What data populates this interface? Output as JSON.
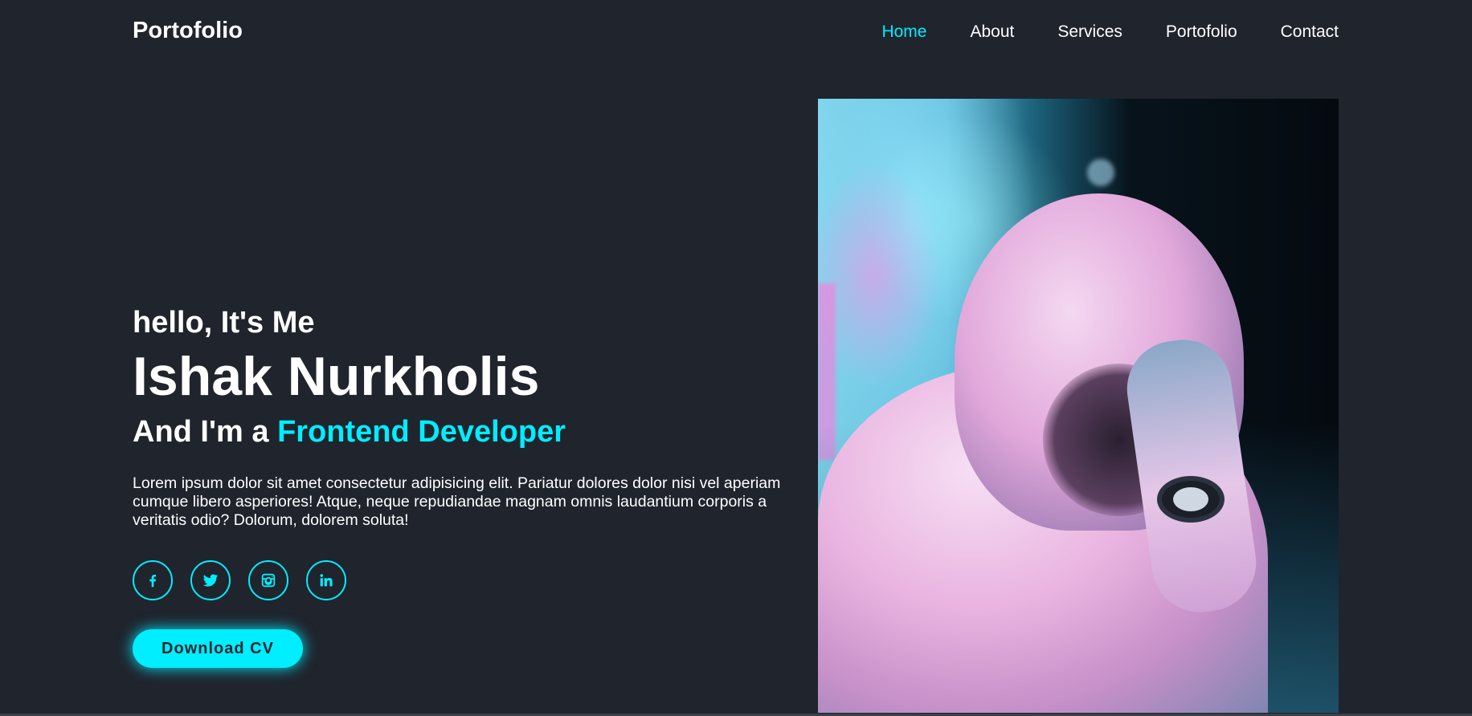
{
  "header": {
    "logo": "Portofolio",
    "nav": [
      {
        "label": "Home",
        "active": true
      },
      {
        "label": "About",
        "active": false
      },
      {
        "label": "Services",
        "active": false
      },
      {
        "label": "Portofolio",
        "active": false
      },
      {
        "label": "Contact",
        "active": false
      }
    ]
  },
  "hero": {
    "greeting": "hello, It's Me",
    "name": "Ishak Nurkholis",
    "role_prefix": "And I'm a ",
    "role_accent": "Frontend Developer",
    "description": "Lorem ipsum dolor sit amet consectetur adipisicing elit. Pariatur dolores dolor nisi vel aperiam cumque libero asperiores! Atque, neque repudiandae magnam omnis laudantium corporis a veritatis odio? Dolorum, dolorem soluta!",
    "socials": [
      {
        "icon": "facebook-icon"
      },
      {
        "icon": "twitter-icon"
      },
      {
        "icon": "instagram-icon"
      },
      {
        "icon": "linkedin-icon"
      }
    ],
    "cta_label": "Download CV",
    "image_alt": "person in hoodie with neon lighting"
  },
  "colors": {
    "background": "#1f242d",
    "accent": "#00eeff",
    "text": "#ffffff"
  }
}
